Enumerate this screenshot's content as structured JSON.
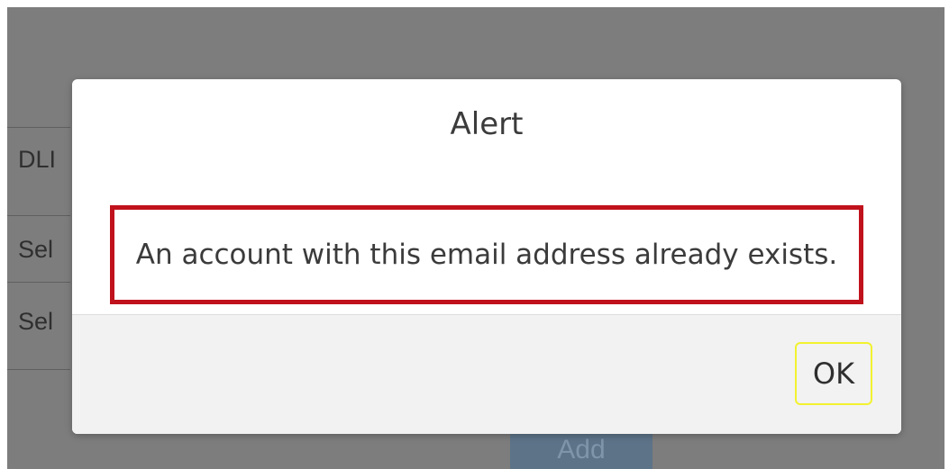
{
  "background": {
    "rows": [
      {
        "label": "DLI"
      },
      {
        "label": "Sel"
      },
      {
        "label": "Sel"
      }
    ],
    "add_button": "Add"
  },
  "dialog": {
    "title": "Alert",
    "message": "An account with this email address already exists.",
    "ok_label": "OK"
  },
  "colors": {
    "overlay": "#7d7d7d",
    "message_highlight_border": "#c0121c",
    "ok_focus_border": "#f2f230",
    "footer_bg": "#f2f2f2"
  }
}
